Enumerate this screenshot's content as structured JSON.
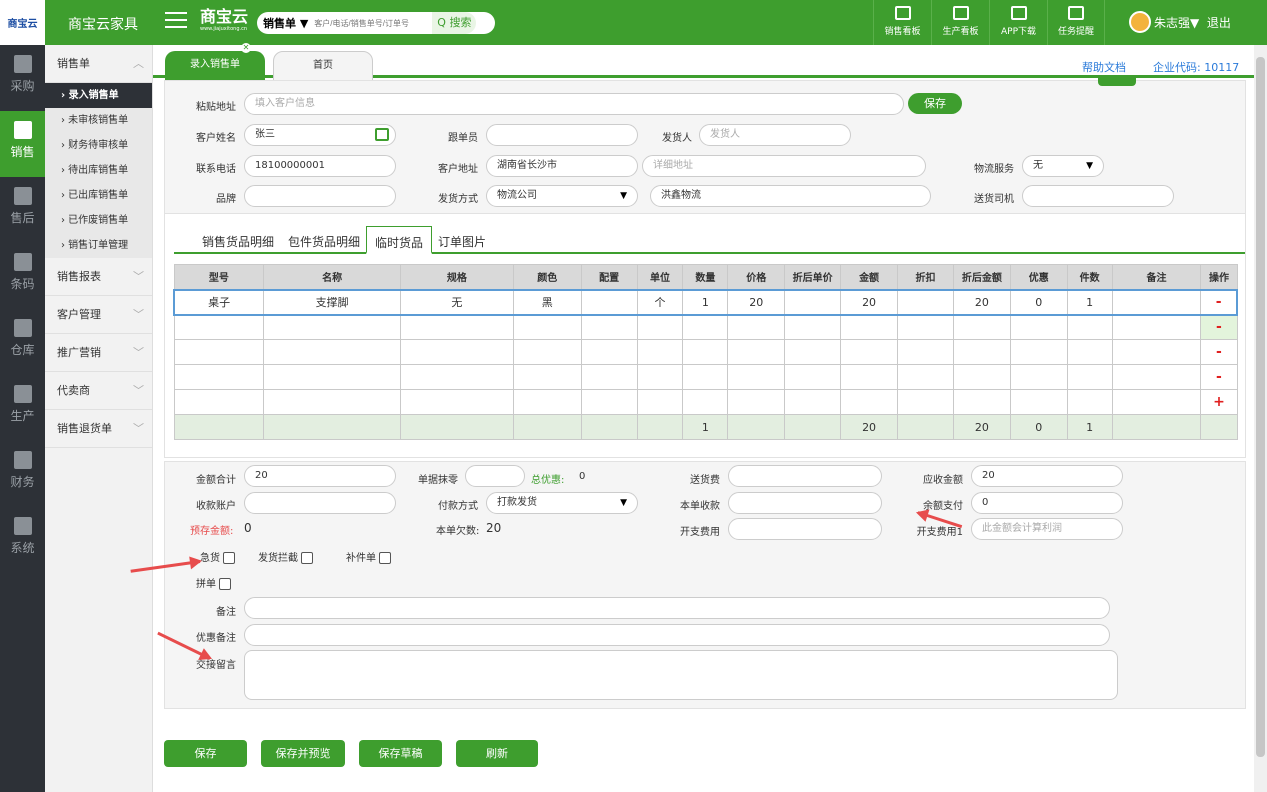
{
  "app": {
    "logo": "商宝云",
    "name": "商宝云家具",
    "brand": "商宝云",
    "brand_sub": "www.jiajuxitong.cn"
  },
  "search": {
    "select": "销售单 ▼",
    "placeholder": "客户/电话/销售单号/订单号",
    "button": "Q 搜索"
  },
  "top_buttons": [
    "销售看板",
    "生产看板",
    "APP下载",
    "任务提醒"
  ],
  "user": {
    "name": "朱志强▼",
    "logout": "退出"
  },
  "left_nav": [
    "采购",
    "销售",
    "售后",
    "条码",
    "仓库",
    "生产",
    "财务",
    "系统"
  ],
  "submenu": {
    "header": "销售单",
    "items": [
      "› 录入销售单",
      "› 未审核销售单",
      "› 财务待审核单",
      "› 待出库销售单",
      "› 已出库销售单",
      "› 已作废销售单",
      "› 销售订单管理"
    ],
    "groups": [
      "销售报表",
      "客户管理",
      "推广营销",
      "代卖商",
      "销售退货单"
    ]
  },
  "tabs": [
    "录入销售单",
    "首页"
  ],
  "help": "帮助文档",
  "company": "企业代码: 10117",
  "form": {
    "paste_label": "粘贴地址",
    "paste_ph": "填入客户信息",
    "save": "保存",
    "name_label": "客户姓名",
    "name": "张三",
    "follow_label": "跟单员",
    "follow": "",
    "shipper_label": "发货人",
    "shipper_ph": "发货人",
    "phone_label": "联系电话",
    "phone": "18100000001",
    "addr_label": "客户地址",
    "addr": "湖南省长沙市",
    "addr_detail_ph": "详细地址",
    "logistics_label": "物流服务",
    "logistics": "无",
    "brand_label": "品牌",
    "brand": "",
    "ship_label": "发货方式",
    "ship": "物流公司",
    "ship_company": "洪鑫物流",
    "driver_label": "送货司机",
    "driver": ""
  },
  "subtabs": [
    "销售货品明细",
    "包件货品明细",
    "临时货品",
    "订单图片"
  ],
  "table": {
    "headers": [
      "型号",
      "名称",
      "规格",
      "颜色",
      "配置",
      "单位",
      "数量",
      "价格",
      "折后单价",
      "金额",
      "折扣",
      "折后金额",
      "优惠",
      "件数",
      "备注",
      "操作"
    ],
    "row1": [
      "桌子",
      "支撑脚",
      "无",
      "黑",
      "",
      "个",
      "1",
      "20",
      "",
      "20",
      "",
      "20",
      "0",
      "1",
      "",
      ""
    ],
    "ops": [
      "-",
      "-",
      "-",
      "-",
      "+"
    ],
    "sum": [
      "",
      "",
      "",
      "",
      "",
      "",
      "1",
      "",
      "",
      "20",
      "",
      "20",
      "0",
      "1",
      "",
      ""
    ]
  },
  "totals": {
    "amount_label": "金额合计",
    "amount": "20",
    "round_label": "单据抹零",
    "round": "",
    "discount_label": "总优惠:",
    "discount": "0",
    "delivery_label": "送货费",
    "delivery": "",
    "receivable_label": "应收金额",
    "receivable": "20",
    "account_label": "收款账户",
    "account": "",
    "pay_label": "付款方式",
    "pay": "打款发货",
    "received_label": "本单收款",
    "received": "",
    "balance_label": "余额支付",
    "balance": "0",
    "prestore_label": "预存金额:",
    "prestore": "0",
    "owed_label": "本单欠数:",
    "owed": "20",
    "expense_label": "开支费用",
    "expense": "",
    "expense1_label": "开支费用1",
    "expense1_ph": "此金额会计算利润",
    "urgent": "急货",
    "intercept": "发货拦截",
    "parts": "补件单",
    "combine": "拼单",
    "remark": "备注",
    "disc_remark": "优惠备注",
    "handover": "交接留言"
  },
  "bottom_buttons": [
    "保存",
    "保存并预览",
    "保存草稿",
    "刷新"
  ],
  "colors": {
    "green": "#3e9e2e",
    "dark": "#2d3137",
    "red": "#e74c4c",
    "link": "#2a7ad9"
  }
}
